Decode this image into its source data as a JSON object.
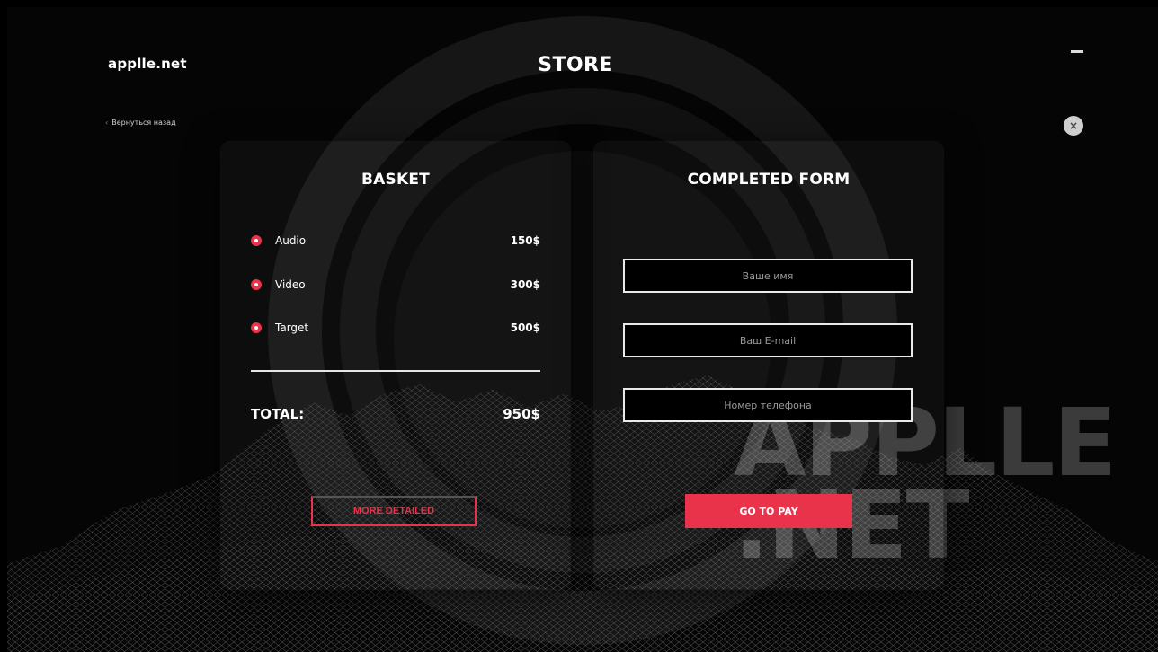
{
  "header": {
    "brand": "applle.net",
    "back_link": "Вернуться назад",
    "title": "STORE",
    "minimize_icon": "minimize-icon",
    "close_icon": "close-icon",
    "close_glyph": "×"
  },
  "watermark": {
    "line1": "APPLLE",
    "line2": ".NET"
  },
  "basket": {
    "title": "BASKET",
    "items": [
      {
        "name": "Audio",
        "price": "150$"
      },
      {
        "name": "Video",
        "price": "300$"
      },
      {
        "name": "Target",
        "price": "500$"
      }
    ],
    "total_label": "TOTAL:",
    "total_value": "950$",
    "more_button": "MORE DETAILED"
  },
  "form": {
    "title": "COMPLETED FORM",
    "fields": [
      {
        "placeholder": "Ваше имя"
      },
      {
        "placeholder": "Ваш E-mail"
      },
      {
        "placeholder": "Номер телефона"
      }
    ],
    "pay_button": "GO TO PAY"
  },
  "colors": {
    "accent": "#e8334a",
    "background": "#000000",
    "text": "#ffffff"
  }
}
